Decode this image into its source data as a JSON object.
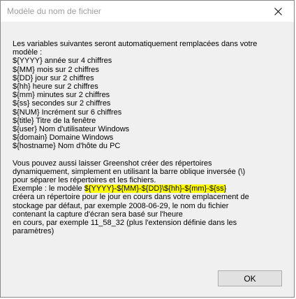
{
  "window": {
    "title": "Modèle du nom de fichier",
    "close_icon": "close-icon"
  },
  "content": {
    "intro_line1": "Les variables suivantes seront automatiquement remplacées dans votre",
    "intro_line2": "modèle :",
    "variables": [
      "${YYYY} année sur 4 chiffres",
      "${MM} mois sur 2 chiffres",
      "${DD} jour sur 2 chiffres",
      "${hh} heure sur 2 chiffres",
      "${mm} minutes sur 2 chiffres",
      "${ss} secondes sur 2 chiffres",
      "${NUM} Incrément sur 6 chiffres",
      "${title} Titre de la fenêtre",
      "${user} Nom d'utilisateur Windows",
      "${domain} Domaine Windows",
      "${hostname} Nom d'hôte du PC"
    ],
    "para2_line1": "Vous pouvez aussi laisser Greenshot créer des répertoires",
    "para2_line2": "dynamiquement, simplement en utilisant la barre oblique inversée (\\)",
    "para2_line3": "pour séparer les répertoires et les fichiers.",
    "example_prefix": "Exemple : le modèle ",
    "example_pattern": "${YYYY}-${MM}-${DD}\\${hh}-${mm}-${ss}",
    "para3_line1": "créera un répertoire pour le jour en cours dans votre emplacement de",
    "para3_line2": "stockage par défaut, par exemple 2008-06-29, le nom du fichier",
    "para3_line3": "contenant la capture d'écran sera basé sur l'heure",
    "para3_line4": "en cours, par exemple 11_58_32 (plus l'extension définie dans les",
    "para3_line5": "paramètres)"
  },
  "buttons": {
    "ok_label": "OK"
  },
  "colors": {
    "highlight": "#ffff00",
    "title_text": "#a0a0a0"
  }
}
